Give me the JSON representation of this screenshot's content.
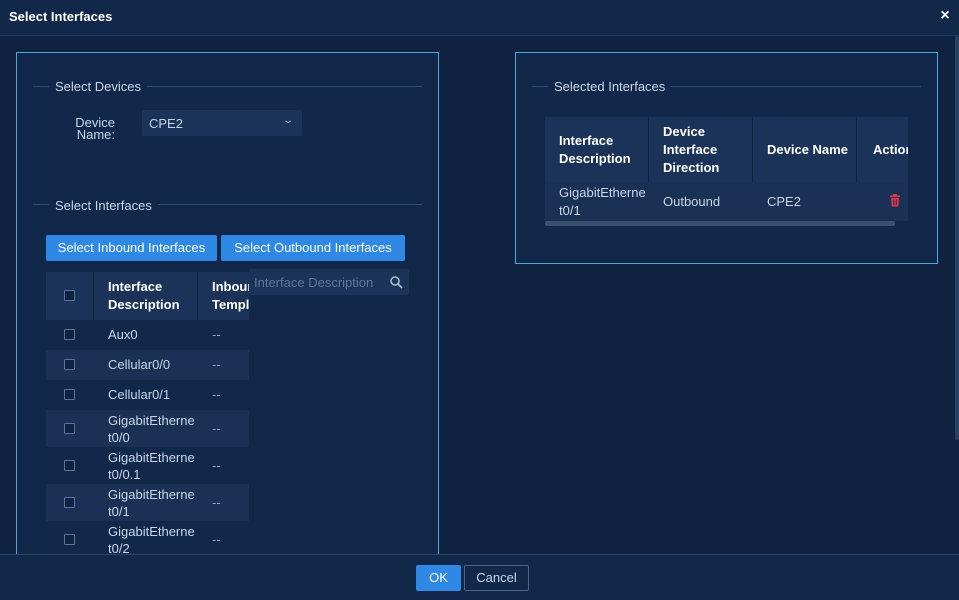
{
  "dialog": {
    "title": "Select Interfaces",
    "close_symbol": "×"
  },
  "left_panel": {
    "devices_legend": "Select Devices",
    "device_name_label": "Device Name:",
    "device_name_value": "CPE2",
    "interfaces_legend": "Select Interfaces",
    "inbound_button": "Select Inbound Interfaces",
    "outbound_button": "Select Outbound Interfaces",
    "search_placeholder": "Interface Description",
    "table": {
      "headers": {
        "description": "Interface Description",
        "template": "Inbound Templ"
      },
      "rows": [
        {
          "description": "Aux0",
          "template": "--"
        },
        {
          "description": "Cellular0/0",
          "template": "--"
        },
        {
          "description": "Cellular0/1",
          "template": "--"
        },
        {
          "description": "GigabitEthernet0/0",
          "template": "--"
        },
        {
          "description": "GigabitEthernet0/0.1",
          "template": "--"
        },
        {
          "description": "GigabitEthernet0/1",
          "template": "--"
        },
        {
          "description": "GigabitEthernet0/2",
          "template": "--"
        }
      ]
    }
  },
  "right_panel": {
    "legend": "Selected Interfaces",
    "table": {
      "headers": {
        "description": "Interface Description",
        "direction": "Device Interface Direction",
        "device_name": "Device Name",
        "action": "Action"
      },
      "rows": [
        {
          "description": "GigabitEthernet0/1",
          "direction": "Outbound",
          "device_name": "CPE2"
        }
      ]
    }
  },
  "footer": {
    "ok": "OK",
    "cancel": "Cancel"
  },
  "colors": {
    "accent": "#2f88e4",
    "panel_border": "#4aa8d8",
    "delete": "#e0344e"
  }
}
